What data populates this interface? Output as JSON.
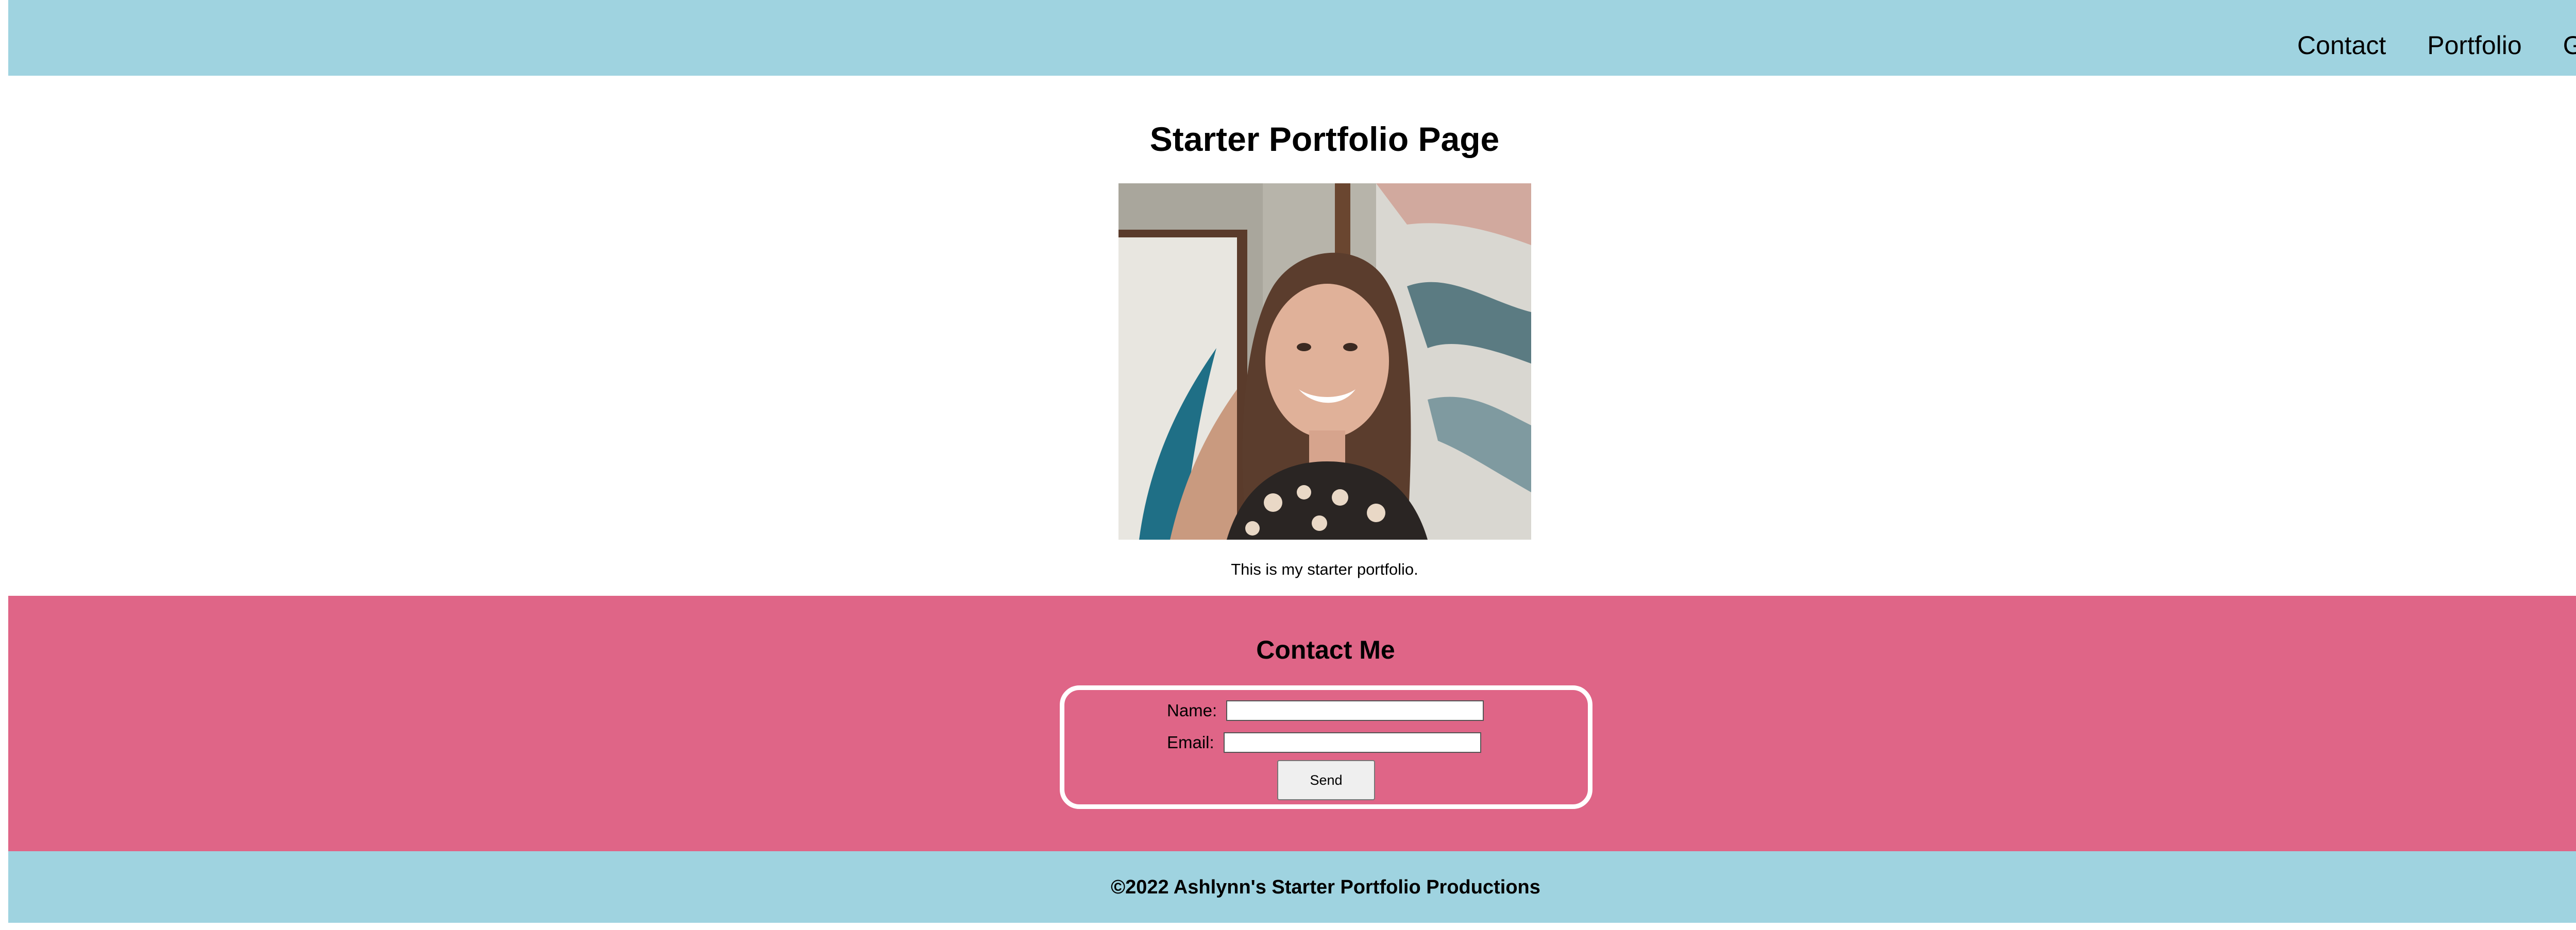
{
  "header": {
    "nav": [
      "Contact",
      "Portfolio",
      "Github"
    ]
  },
  "main": {
    "title": "Starter Portfolio Page",
    "photo": "portrait-photo",
    "intro": "This is my starter portfolio."
  },
  "contact": {
    "title": "Contact Me",
    "name_label": "Name:",
    "name_value": "",
    "email_label": "Email:",
    "email_value": "",
    "send_label": "Send"
  },
  "footer": {
    "text": "©2022 Ashlynn's Starter Portfolio Productions"
  },
  "colors": {
    "header_bg": "#9fd3e0",
    "contact_bg": "#df6587",
    "footer_bg": "#9fd3e0"
  }
}
